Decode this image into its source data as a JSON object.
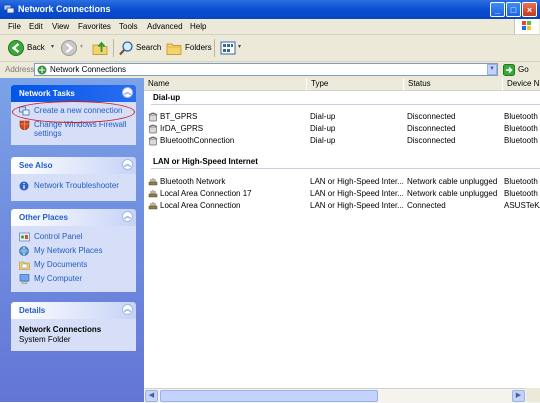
{
  "window": {
    "title": "Network Connections"
  },
  "menu": [
    "File",
    "Edit",
    "View",
    "Favorites",
    "Tools",
    "Advanced",
    "Help"
  ],
  "toolbar": {
    "back": "Back",
    "search": "Search",
    "folders": "Folders"
  },
  "address": {
    "label": "Address",
    "value": "Network Connections",
    "go": "Go"
  },
  "columns": [
    "Name",
    "Type",
    "Status",
    "Device Na"
  ],
  "groups": [
    {
      "title": "Dial-up",
      "rows": [
        {
          "name": "BT_GPRS",
          "type": "Dial-up",
          "status": "Disconnected",
          "device": "Bluetooth"
        },
        {
          "name": "IrDA_GPRS",
          "type": "Dial-up",
          "status": "Disconnected",
          "device": "Bluetooth"
        },
        {
          "name": "BluetoothConnection",
          "type": "Dial-up",
          "status": "Disconnected",
          "device": "Bluetooth"
        }
      ]
    },
    {
      "title": "LAN or High-Speed Internet",
      "rows": [
        {
          "name": "Bluetooth Network",
          "type": "LAN or High-Speed Inter...",
          "status": "Network cable unplugged",
          "device": "Bluetooth"
        },
        {
          "name": "Local Area Connection 17",
          "type": "LAN or High-Speed Inter...",
          "status": "Network cable unplugged",
          "device": "Bluetooth"
        },
        {
          "name": "Local Area Connection",
          "type": "LAN or High-Speed Inter...",
          "status": "Connected",
          "device": "ASUSTeK/"
        }
      ]
    }
  ],
  "left": {
    "network_tasks": {
      "title": "Network Tasks",
      "items": [
        "Create a new connection",
        "Change Windows Firewall settings"
      ]
    },
    "see_also": {
      "title": "See Also",
      "items": [
        "Network Troubleshooter"
      ]
    },
    "other_places": {
      "title": "Other Places",
      "items": [
        "Control Panel",
        "My Network Places",
        "My Documents",
        "My Computer"
      ]
    },
    "details": {
      "title": "Details",
      "name": "Network Connections",
      "type": "System Folder"
    }
  },
  "colors": {
    "titlebar": "#0a4ed3",
    "link": "#215dc6",
    "highlight": "#d21c1c"
  }
}
